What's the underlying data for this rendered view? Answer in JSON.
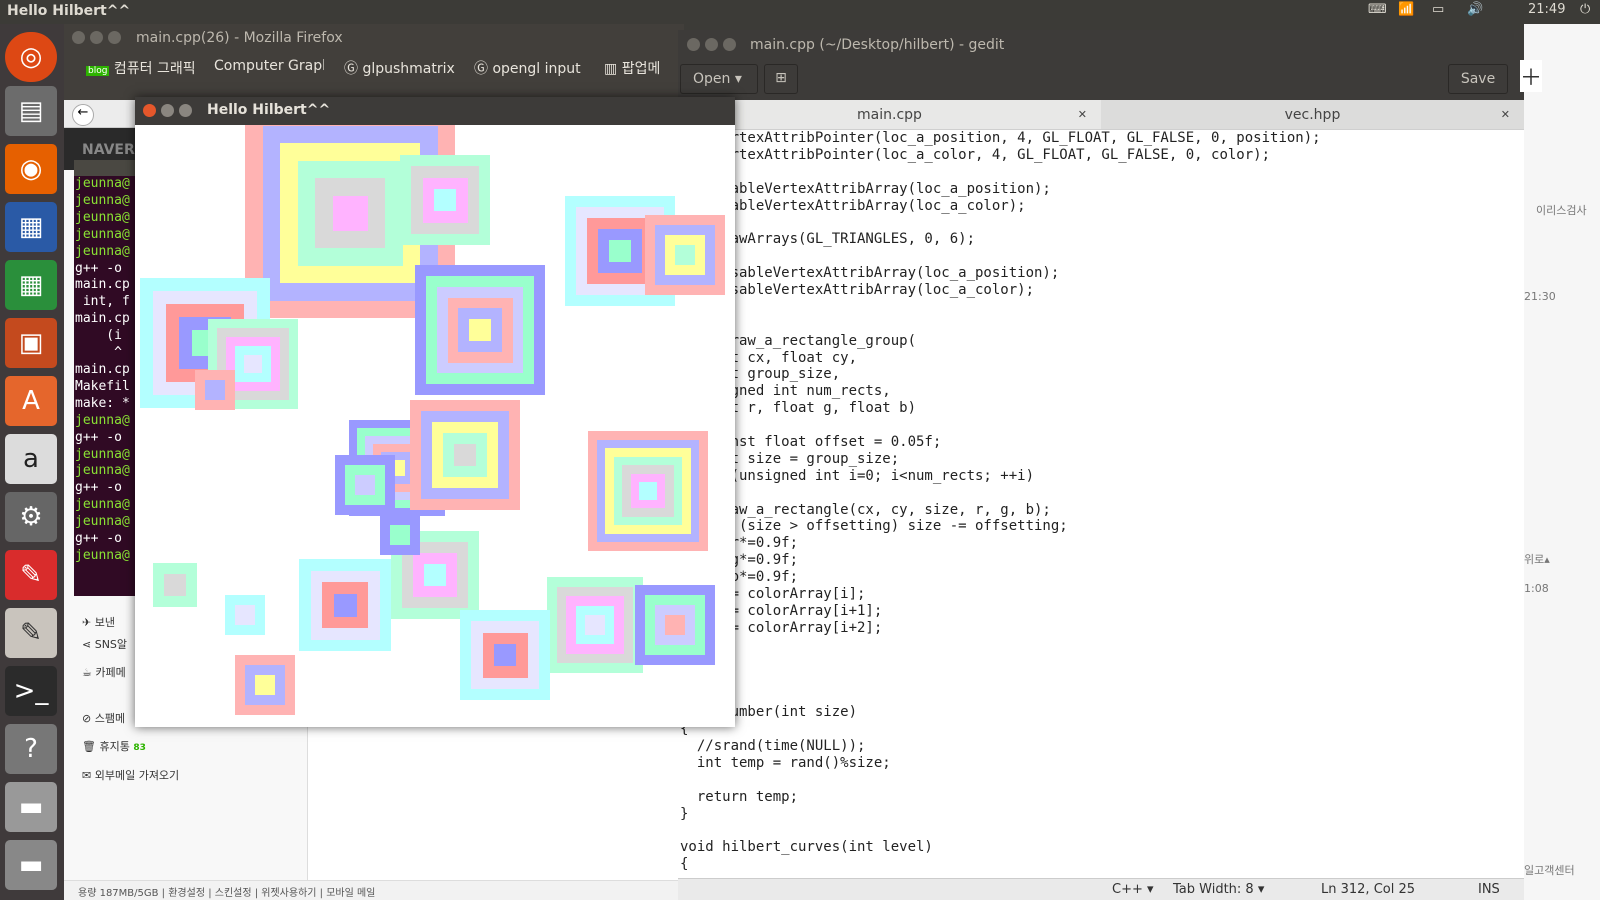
{
  "topbar": {
    "title": "Hello Hilbert^^",
    "time": "21:49"
  },
  "firefox": {
    "window_title": "main.cpp(26) - Mozilla Firefox",
    "tabs": [
      "컴퓨터 그래픽",
      "Computer Graph",
      "glpushmatrix",
      "opengl input",
      "팝업메"
    ],
    "sidebar": [
      "보낸",
      "SNS알",
      "카페메",
      "스팸메",
      "휴지통",
      "외부메일 가져오기"
    ],
    "trash_count": "83",
    "naver": "NAVER",
    "footer": "용량 187MB/5GB  |  환경설정  |  스킨설정  |  위젯사용하기  |  모바일 메일"
  },
  "terminal": [
    "jeunna@",
    "jeunna@",
    "jeunna@",
    "jeunna@",
    "jeunna@",
    "g++ -o",
    "main.cp",
    " int, f",
    "main.cp",
    "    (i",
    "     ^",
    "main.cp",
    "Makefil",
    "make: *",
    "jeunna@",
    "g++ -o",
    "jeunna@",
    "jeunna@",
    "g++ -o",
    "jeunna@",
    "jeunna@",
    "g++ -o",
    "jeunna@"
  ],
  "gedit": {
    "window_title": "main.cpp (~/Desktop/hilbert) - gedit",
    "open_label": "Open",
    "save_label": "Save",
    "tab1": "main.cpp",
    "tab2": "vec.hpp",
    "status_lang": "C++",
    "status_tab": "Tab Width: 8",
    "status_pos": "Ln 312, Col 25",
    "status_mode": "INS"
  },
  "hilbert": {
    "title": "Hello Hilbert^^"
  },
  "right": {
    "a": "이리스검사",
    "b": "21:30",
    "c": "위로▴",
    "d": "1:08",
    "e": "일고객센터"
  }
}
